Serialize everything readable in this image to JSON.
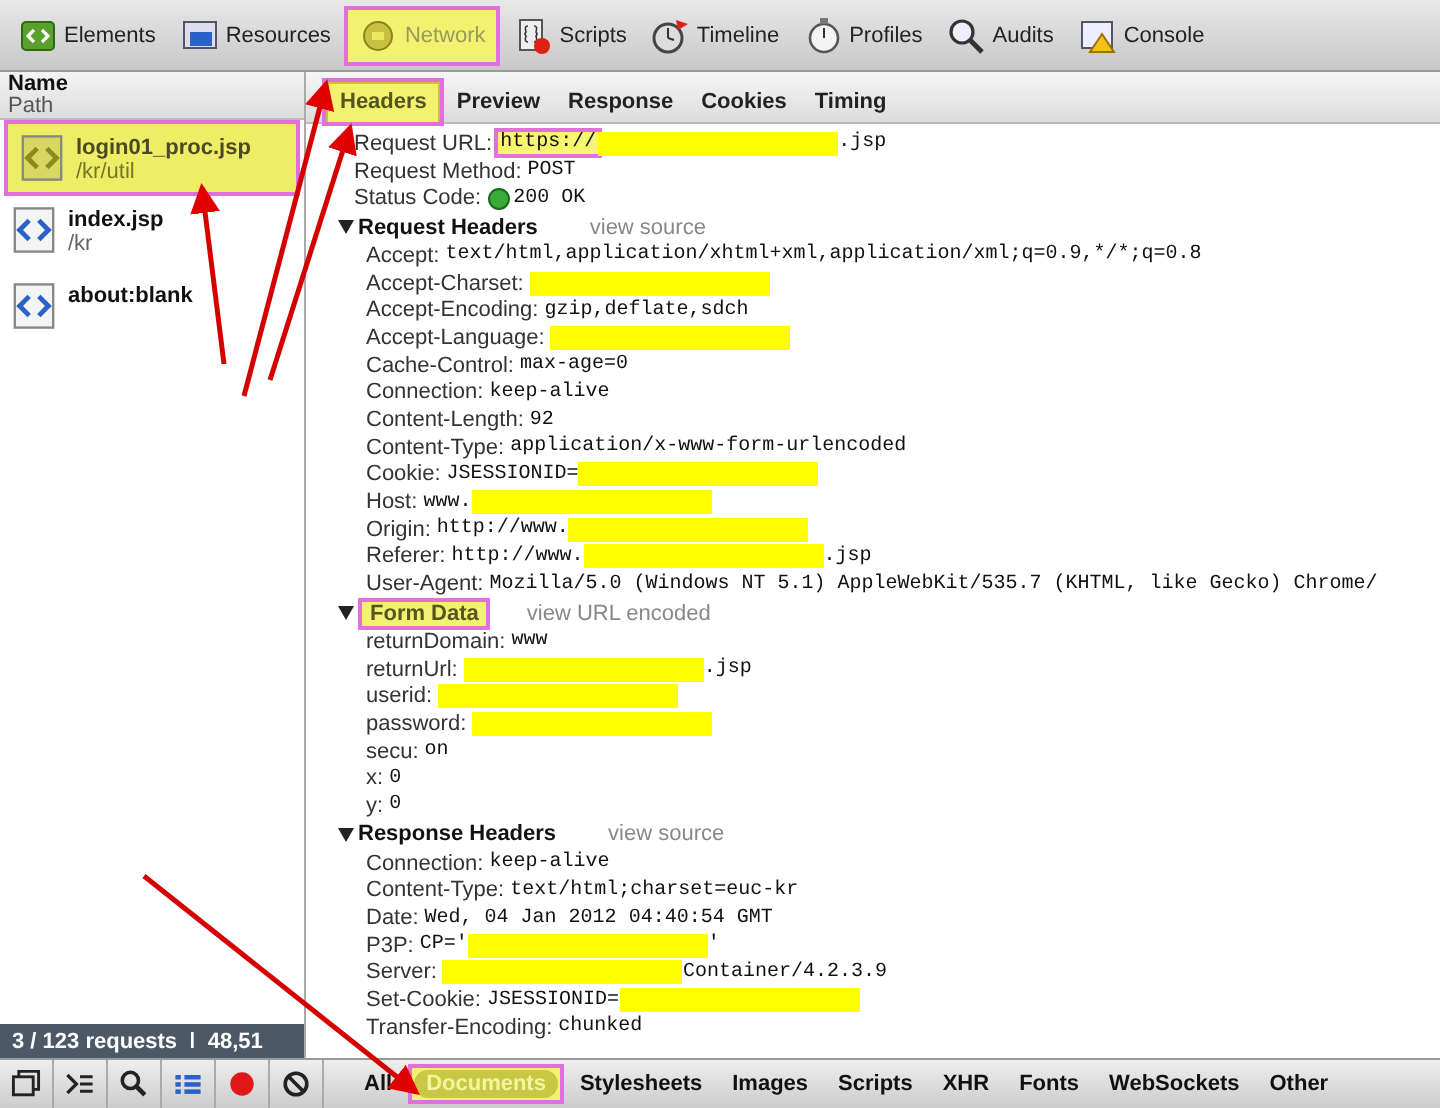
{
  "toolbar": [
    {
      "label": "Elements",
      "highlighted": false
    },
    {
      "label": "Resources",
      "highlighted": false
    },
    {
      "label": "Network",
      "highlighted": true
    },
    {
      "label": "Scripts",
      "highlighted": false
    },
    {
      "label": "Timeline",
      "highlighted": false
    },
    {
      "label": "Profiles",
      "highlighted": false
    },
    {
      "label": "Audits",
      "highlighted": false
    },
    {
      "label": "Console",
      "highlighted": false
    }
  ],
  "sidebar": {
    "columns": [
      "Name",
      "Path"
    ],
    "items": [
      {
        "name": "login01_proc.jsp",
        "path": "/kr/util",
        "selected": true,
        "highlighted": true
      },
      {
        "name": "index.jsp",
        "path": "/kr",
        "selected": false,
        "highlighted": false
      },
      {
        "name": "about:blank",
        "selected": false,
        "highlighted": false
      }
    ]
  },
  "detail_tabs": [
    {
      "label": "Headers",
      "selected": true,
      "highlighted": true
    },
    {
      "label": "Preview",
      "selected": false,
      "highlighted": false
    },
    {
      "label": "Response",
      "selected": false,
      "highlighted": false
    },
    {
      "label": "Cookies",
      "selected": false,
      "highlighted": false
    },
    {
      "label": "Timing",
      "selected": false,
      "highlighted": false
    }
  ],
  "general": [
    {
      "name": "Request URL:",
      "value": "https://",
      "value_highlighted": true,
      "redacted": true,
      "after": ".jsp"
    },
    {
      "name": "Request Method:",
      "value": "POST"
    },
    {
      "name": "Status Code:",
      "value": "200 OK",
      "kind": "status"
    }
  ],
  "sections": [
    {
      "title": "Request Headers",
      "link": "view source",
      "expanded": true,
      "highlighted": false,
      "rows": [
        {
          "name": "Accept:",
          "value": "text/html,application/xhtml+xml,application/xml;q=0.9,*/*;q=0.8"
        },
        {
          "name": "Accept-Charset:",
          "value": "",
          "redacted": true
        },
        {
          "name": "Accept-Encoding:",
          "value": "gzip,deflate,sdch"
        },
        {
          "name": "Accept-Language:",
          "value": "",
          "redacted": true
        },
        {
          "name": "Cache-Control:",
          "value": "max-age=0"
        },
        {
          "name": "Connection:",
          "value": "keep-alive"
        },
        {
          "name": "Content-Length:",
          "value": "92"
        },
        {
          "name": "Content-Type:",
          "value": "application/x-www-form-urlencoded"
        },
        {
          "name": "Cookie:",
          "value": "JSESSIONID=",
          "redacted": true
        },
        {
          "name": "Host:",
          "value": "www.",
          "redacted": true
        },
        {
          "name": "Origin:",
          "value": "http://www.",
          "redacted": true
        },
        {
          "name": "Referer:",
          "value": "http://www.",
          "redacted": true,
          "after": ".jsp"
        },
        {
          "name": "User-Agent:",
          "value": "Mozilla/5.0 (Windows NT 5.1) AppleWebKit/535.7 (KHTML, like Gecko) Chrome/"
        }
      ]
    },
    {
      "title": "Form Data",
      "link": "view URL encoded",
      "expanded": true,
      "highlighted": true,
      "rows": [
        {
          "name": "returnDomain:",
          "value": "www"
        },
        {
          "name": "returnUrl:",
          "value": "",
          "redacted": true,
          "after": ".jsp"
        },
        {
          "name": "userid:",
          "value": "",
          "redacted": true
        },
        {
          "name": "password:",
          "value": "",
          "redacted": true
        },
        {
          "name": "secu:",
          "value": "on"
        },
        {
          "name": "x:",
          "value": "0"
        },
        {
          "name": "y:",
          "value": "0"
        }
      ]
    },
    {
      "title": "Response Headers",
      "link": "view source",
      "expanded": true,
      "highlighted": false,
      "rows": [
        {
          "name": "Connection:",
          "value": "keep-alive"
        },
        {
          "name": "Content-Type:",
          "value": "text/html;charset=euc-kr"
        },
        {
          "name": "Date:",
          "value": "Wed, 04 Jan 2012 04:40:54 GMT"
        },
        {
          "name": "P3P:",
          "value": "CP='",
          "redacted": true,
          "after": "'"
        },
        {
          "name": "Server:",
          "value": "",
          "redacted": true,
          "after": "Container/4.2.3.9"
        },
        {
          "name": "Set-Cookie:",
          "value": "JSESSIONID=",
          "redacted": true
        },
        {
          "name": "Transfer-Encoding:",
          "value": "chunked"
        }
      ]
    }
  ],
  "status_bar": {
    "summary": "3 / 123 requests  ǀ  48,51"
  },
  "bottom_tools": [
    {
      "kind": "dock"
    },
    {
      "kind": "console"
    },
    {
      "kind": "search"
    },
    {
      "kind": "list"
    },
    {
      "kind": "record"
    },
    {
      "kind": "clear"
    }
  ],
  "filters": [
    {
      "label": "All",
      "selected": false,
      "highlighted": false
    },
    {
      "label": "Documents",
      "selected": true,
      "highlighted": true
    },
    {
      "label": "Stylesheets",
      "selected": false,
      "highlighted": false
    },
    {
      "label": "Images",
      "selected": false,
      "highlighted": false
    },
    {
      "label": "Scripts",
      "selected": false,
      "highlighted": false
    },
    {
      "label": "XHR",
      "selected": false,
      "highlighted": false
    },
    {
      "label": "Fonts",
      "selected": false,
      "highlighted": false
    },
    {
      "label": "WebSockets",
      "selected": false,
      "highlighted": false
    },
    {
      "label": "Other",
      "selected": false,
      "highlighted": false
    }
  ]
}
